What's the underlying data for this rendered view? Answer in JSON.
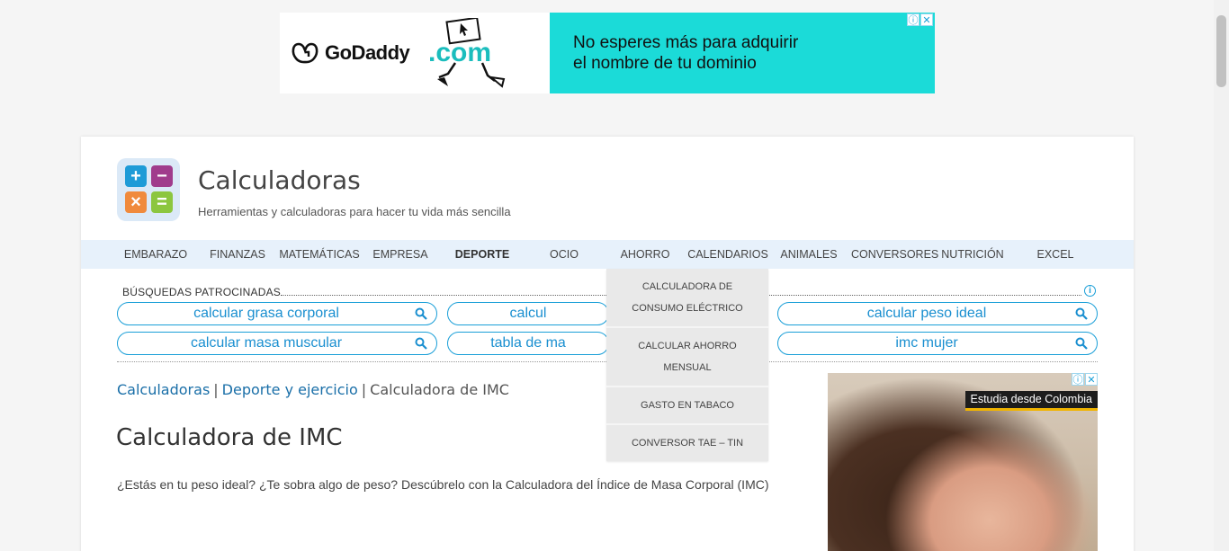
{
  "top_ad": {
    "brand": "GoDaddy",
    "domain_art": ".com",
    "message_line1": "No esperes más para adquirir",
    "message_line2": "el nombre de tu dominio",
    "accent": "#1bdbd8"
  },
  "site": {
    "title": "Calculadoras",
    "subtitle": "Herramientas y calculadoras para hacer tu vida más sencilla"
  },
  "nav": {
    "items": [
      {
        "label": "EMBARAZO"
      },
      {
        "label": "FINANZAS"
      },
      {
        "label": "MATEMÁTICAS"
      },
      {
        "label": "EMPRESA"
      },
      {
        "label": "DEPORTE"
      },
      {
        "label": "OCIO"
      },
      {
        "label": "AHORRO"
      },
      {
        "label": "CALENDARIOS"
      },
      {
        "label": "ANIMALES"
      },
      {
        "label": "CONVERSORES"
      },
      {
        "label": "NUTRICIÓN"
      },
      {
        "label": "EXCEL"
      }
    ],
    "active": "DEPORTE"
  },
  "dropdown": {
    "items": [
      {
        "label": "CALCULADORA DE CONSUMO ELÉCTRICO"
      },
      {
        "label": "CALCULAR AHORRO MENSUAL"
      },
      {
        "label": "GASTO EN TABACO"
      },
      {
        "label": "CONVERSOR TAE – TIN"
      }
    ]
  },
  "sponsored": {
    "heading": "BÚSQUEDAS PATROCINADAS",
    "searches": [
      {
        "label": "calcular grasa corporal"
      },
      {
        "label": "calcul"
      },
      {
        "label": "calcular peso ideal"
      },
      {
        "label": "calcular masa muscular"
      },
      {
        "label": "tabla de ma"
      },
      {
        "label": "imc mujer"
      }
    ]
  },
  "breadcrumb": {
    "home": "Calculadoras",
    "category": "Deporte y ejercicio",
    "current": "Calculadora de IMC",
    "separator": "|"
  },
  "main": {
    "title": "Calculadora de IMC",
    "intro": "¿Estás en tu peso ideal? ¿Te sobra algo de peso? Descúbrelo con la Calculadora del Índice de Masa Corporal (IMC)"
  },
  "side_ad": {
    "tag": "Estudia desde Colombia",
    "accent": "#f0b400"
  },
  "icons": {
    "adchoices": "info-icon",
    "close": "close-icon",
    "search": "search-icon"
  }
}
